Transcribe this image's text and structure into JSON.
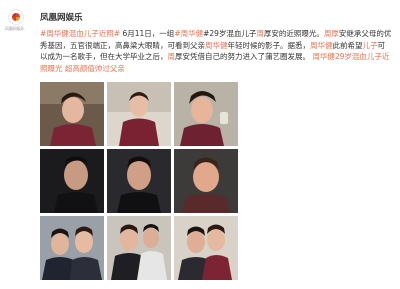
{
  "account": {
    "name": "凤凰网娱乐",
    "logo_caption": "凤凰网娱乐"
  },
  "post": {
    "topic": "#周华健混血儿子近照#",
    "part1": " 6月11日，一组",
    "hl1": "#周华健",
    "part2": "#29岁混血儿子",
    "hl2": "周",
    "part3": "厚安的近照曝光。",
    "hl3": "周厚",
    "part4": "安继承父母的优秀基因，五官很端正，高鼻梁大眼睛，可看到父亲",
    "hl4": "周华健",
    "part5": "年轻时候的影子。据悉，",
    "hl5": "周华健",
    "part6": "此前希望",
    "hl6": "儿子",
    "part7": "可以成为一名歌手，但在大学毕业之后，",
    "hl7": "周",
    "part8": "厚安凭借自己的努力进入了蒲艺圈发展。",
    "link1": "周华健29岁混血儿子近照曝光",
    "link2": "超高颜值帅过父亲"
  },
  "photos": [
    {
      "id": "photo-1"
    },
    {
      "id": "photo-2"
    },
    {
      "id": "photo-3"
    },
    {
      "id": "photo-4"
    },
    {
      "id": "photo-5"
    },
    {
      "id": "photo-6"
    },
    {
      "id": "photo-7"
    },
    {
      "id": "photo-8"
    },
    {
      "id": "photo-9"
    }
  ],
  "colors": {
    "accent": "#eb7350",
    "text": "#333333",
    "link": "#eb7350"
  }
}
